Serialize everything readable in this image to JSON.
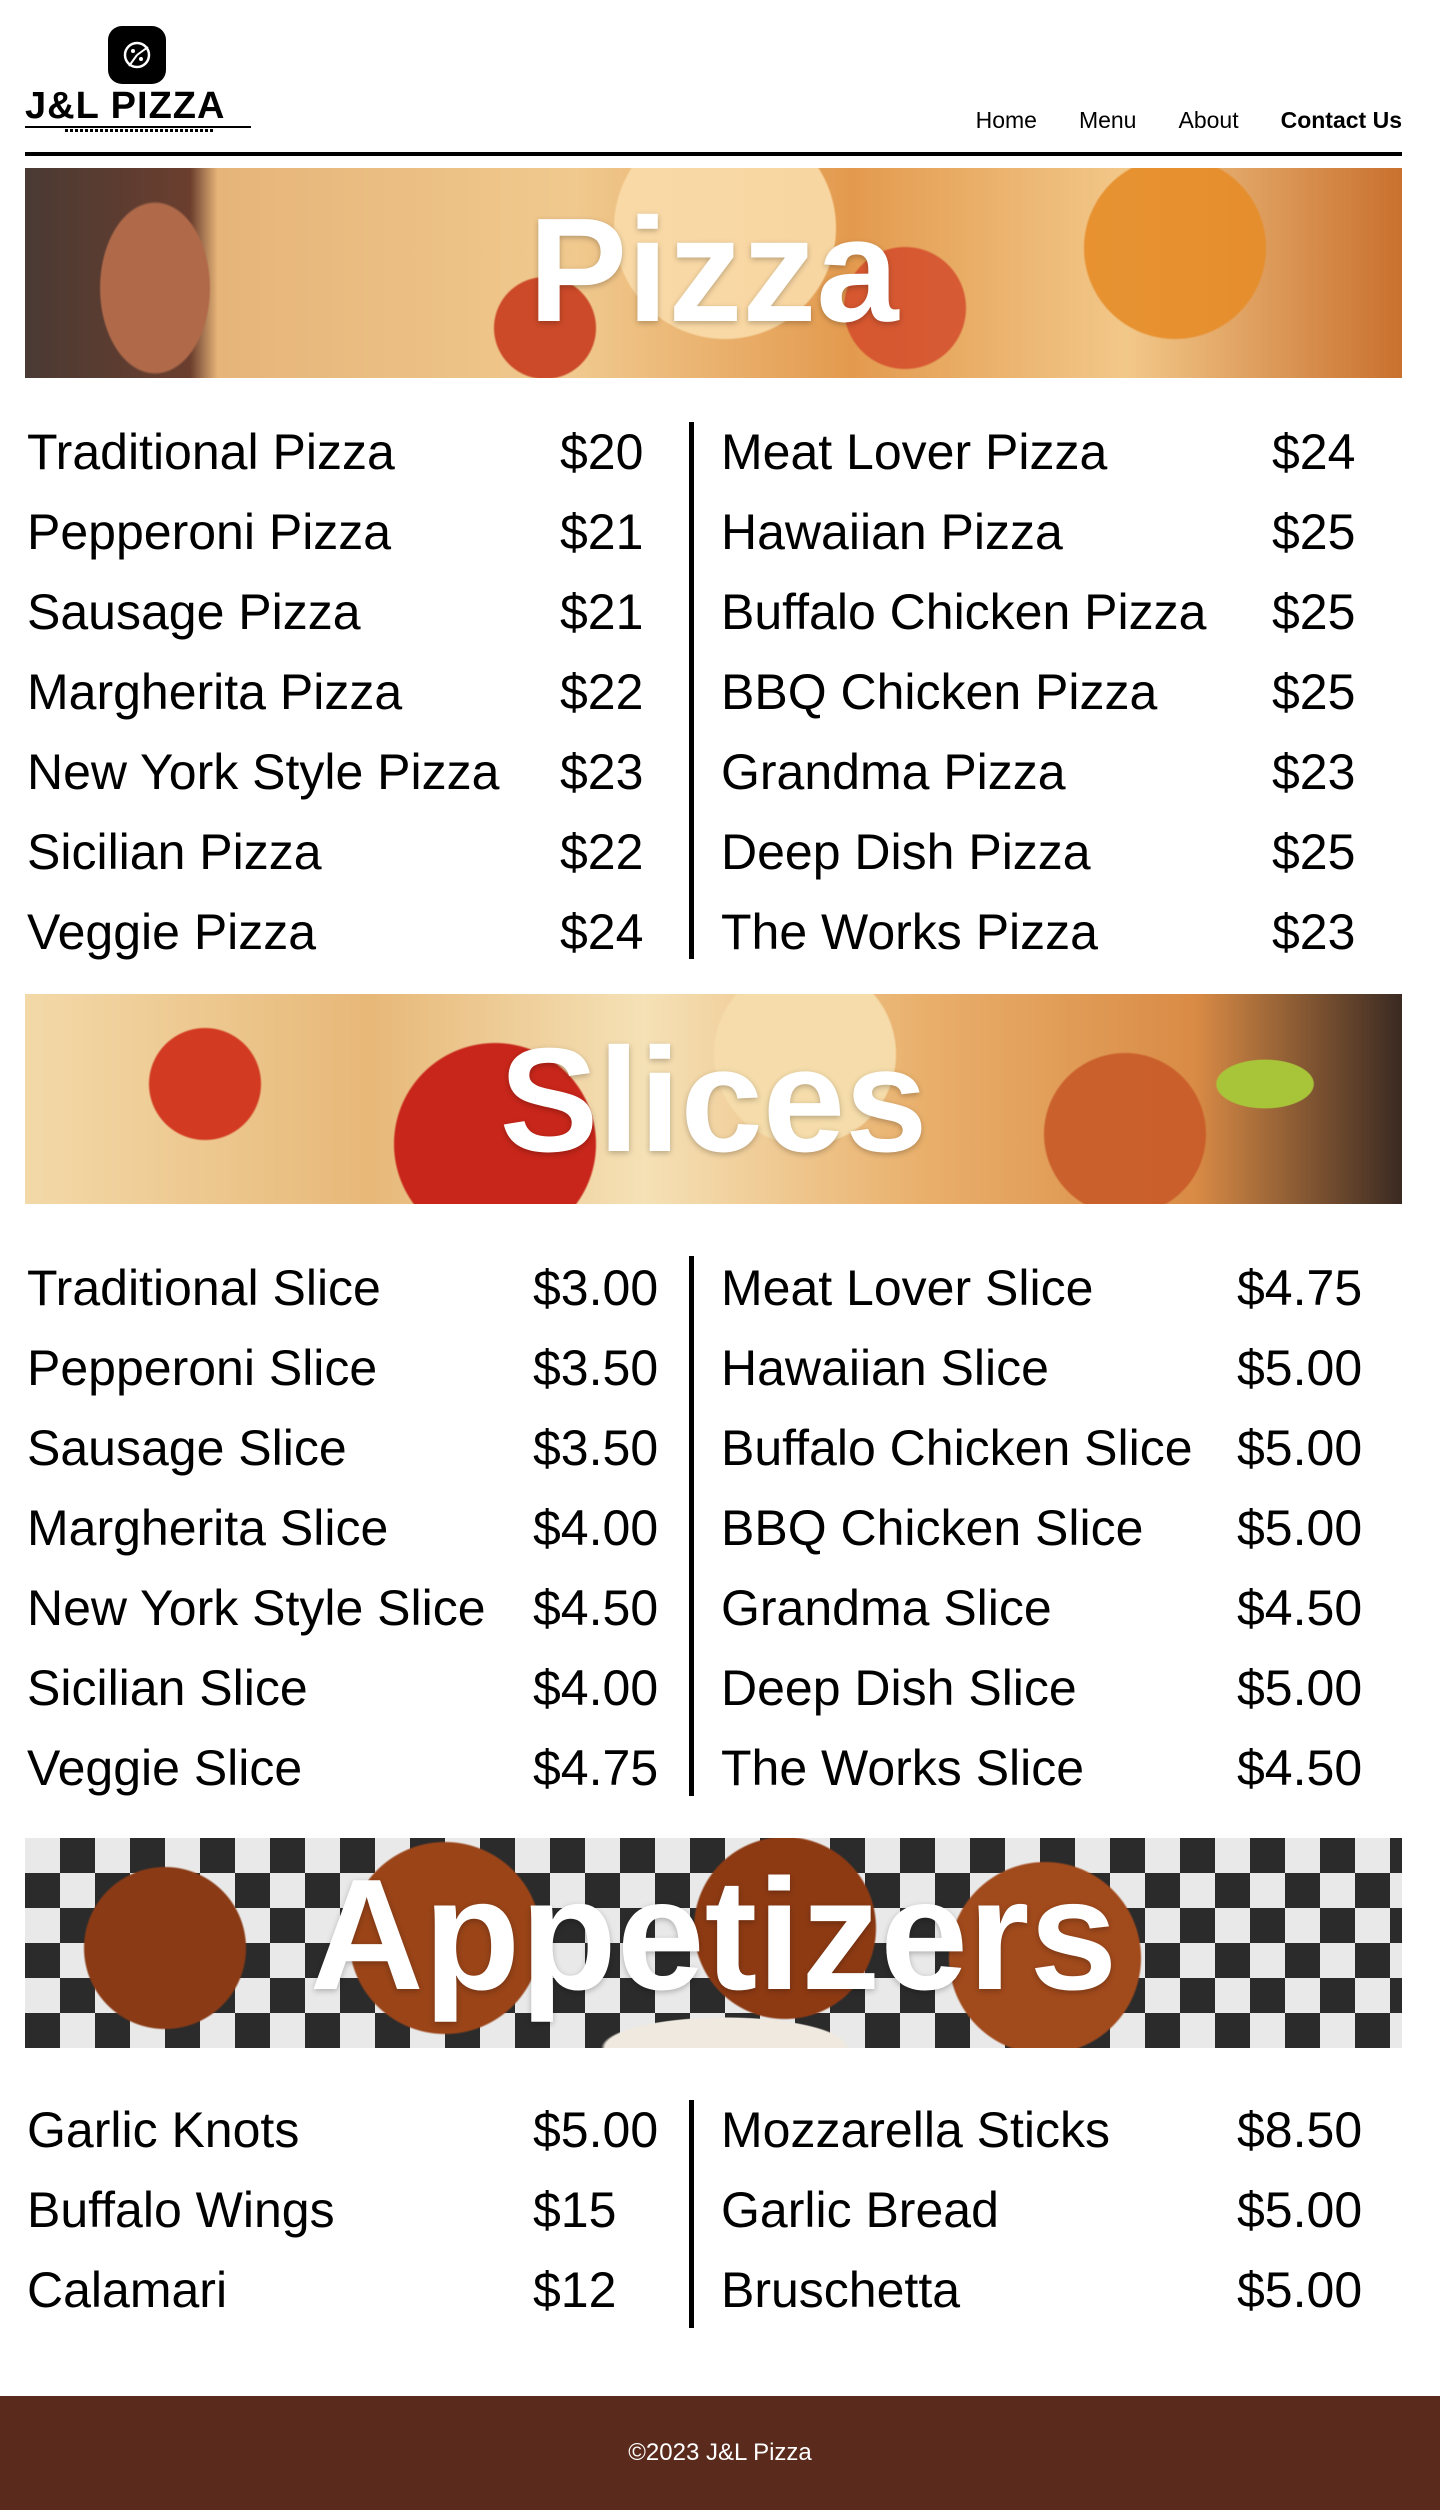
{
  "header": {
    "logo_text": "J&L PIZZA",
    "nav": [
      {
        "label": "Home"
      },
      {
        "label": "Menu"
      },
      {
        "label": "About"
      },
      {
        "label": "Contact Us"
      }
    ]
  },
  "sections": {
    "pizza": {
      "title": "Pizza",
      "left": [
        {
          "name": "Traditional Pizza",
          "price": "$20"
        },
        {
          "name": "Pepperoni Pizza",
          "price": "$21"
        },
        {
          "name": "Sausage Pizza",
          "price": "$21"
        },
        {
          "name": "Margherita Pizza",
          "price": "$22"
        },
        {
          "name": "New York Style Pizza",
          "price": "$23"
        },
        {
          "name": "Sicilian Pizza",
          "price": "$22"
        },
        {
          "name": "Veggie Pizza",
          "price": "$24"
        }
      ],
      "right": [
        {
          "name": "Meat Lover Pizza",
          "price": "$24"
        },
        {
          "name": "Hawaiian Pizza",
          "price": "$25"
        },
        {
          "name": "Buffalo Chicken Pizza",
          "price": "$25"
        },
        {
          "name": "BBQ Chicken Pizza",
          "price": "$25"
        },
        {
          "name": "Grandma Pizza",
          "price": "$23"
        },
        {
          "name": "Deep Dish Pizza",
          "price": "$25"
        },
        {
          "name": "The Works Pizza",
          "price": "$23"
        }
      ]
    },
    "slices": {
      "title": "Slices",
      "left": [
        {
          "name": "Traditional Slice",
          "price": "$3.00"
        },
        {
          "name": "Pepperoni Slice",
          "price": "$3.50"
        },
        {
          "name": "Sausage Slice",
          "price": "$3.50"
        },
        {
          "name": "Margherita Slice",
          "price": "$4.00"
        },
        {
          "name": "New York Style Slice",
          "price": "$4.50"
        },
        {
          "name": "Sicilian Slice",
          "price": "$4.00"
        },
        {
          "name": "Veggie Slice",
          "price": "$4.75"
        }
      ],
      "right": [
        {
          "name": "Meat Lover Slice",
          "price": "$4.75"
        },
        {
          "name": "Hawaiian Slice",
          "price": "$5.00"
        },
        {
          "name": "Buffalo Chicken Slice",
          "price": "$5.00"
        },
        {
          "name": "BBQ Chicken Slice",
          "price": "$5.00"
        },
        {
          "name": "Grandma Slice",
          "price": "$4.50"
        },
        {
          "name": "Deep Dish Slice",
          "price": "$5.00"
        },
        {
          "name": "The Works Slice",
          "price": "$4.50"
        }
      ]
    },
    "appetizers": {
      "title": "Appetizers",
      "left": [
        {
          "name": "Garlic Knots",
          "price": "$5.00"
        },
        {
          "name": "Buffalo Wings",
          "price": "$15"
        },
        {
          "name": "Calamari",
          "price": "$12"
        }
      ],
      "right": [
        {
          "name": "Mozzarella Sticks",
          "price": "$8.50"
        },
        {
          "name": "Garlic Bread",
          "price": "$5.00"
        },
        {
          "name": "Bruschetta",
          "price": "$5.00"
        }
      ]
    }
  },
  "footer": {
    "text": "©2023 J&L Pizza"
  },
  "colors": {
    "footer_bg": "#5a2a1c",
    "text": "#000000",
    "banner_title": "#ffffff"
  }
}
